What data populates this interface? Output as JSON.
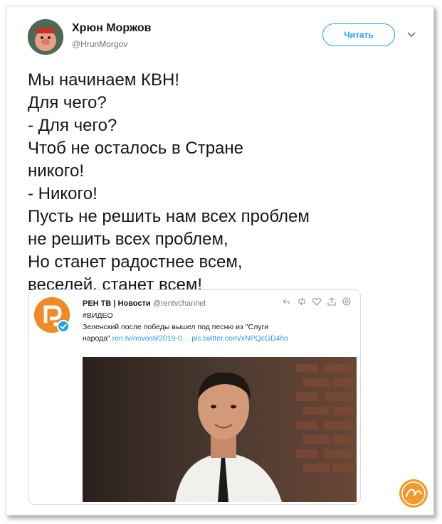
{
  "author": {
    "name": "Хрюн Моржов",
    "handle": "@HrunMorgov"
  },
  "follow_button": "Читать",
  "tweet_text": "Мы начинаем КВН!\nДля чего?\n- Для чего?\nЧтоб не осталось в Стране\nникого!\n- Никого!\nПусть не решить нам всех проблем\nне решить всех проблем,\nНо станет радостнее всем,\nвеселей, станет всем!",
  "quoted_tweet": {
    "author": "РЕН ТВ | Новости",
    "handle": "@rentvchannel",
    "hashtag": "#ВИДЕО",
    "text_line1": "Зеленский после победы вышел под песню из \"Слуги",
    "text_line2_prefix": "народа\"",
    "link1": "ren.tv/novosti/2019-0…",
    "link2": "pic.twitter.com/xNPQcGD4ho"
  },
  "colors": {
    "accent": "#1da1f2",
    "rentv_orange": "#f08a24",
    "text": "#14171a",
    "muted": "#657786"
  },
  "icons": [
    "chevron-down-icon",
    "reply-icon",
    "retweet-icon",
    "like-icon",
    "share-icon",
    "settings-icon",
    "verified-icon"
  ]
}
